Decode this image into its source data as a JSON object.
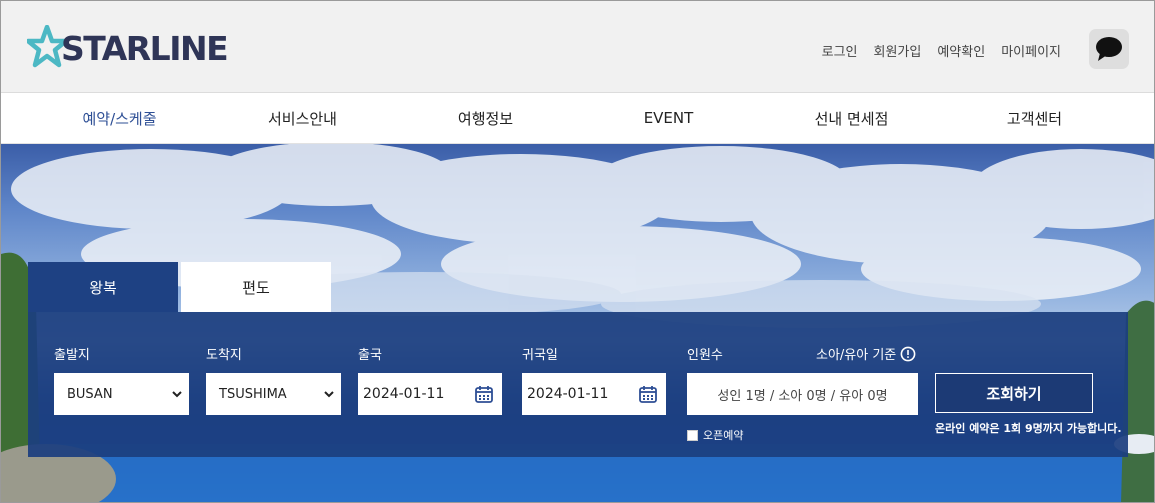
{
  "header": {
    "logo_text": "STARLINE",
    "links": [
      "로그인",
      "회원가입",
      "예약확인",
      "마이페이지"
    ]
  },
  "nav": {
    "items": [
      "예약/스케줄",
      "서비스안내",
      "여행정보",
      "EVENT",
      "선내 면세점",
      "고객센터"
    ],
    "active_index": 0
  },
  "booking": {
    "tabs": [
      "왕복",
      "편도"
    ],
    "active_tab": 0,
    "departure": {
      "label": "출발지",
      "value": "BUSAN"
    },
    "arrival": {
      "label": "도착지",
      "value": "TSUSHIMA"
    },
    "outbound": {
      "label": "출국",
      "value": "2024-01-11"
    },
    "return": {
      "label": "귀국일",
      "value": "2024-01-11"
    },
    "passengers": {
      "label": "인원수",
      "info_label": "소아/유아 기준",
      "value": "성인 1명 / 소아 0명 / 유아 0명"
    },
    "open_booking_label": "오픈예약",
    "search_label": "조회하기",
    "note": "온라인 예약은 1회 9명까지 가능합니다."
  },
  "colors": {
    "brand_navy": "#2f3557",
    "logo_star": "#4cb8c4",
    "panel": "#1c3e7f",
    "nav_active": "#2e4f95"
  }
}
